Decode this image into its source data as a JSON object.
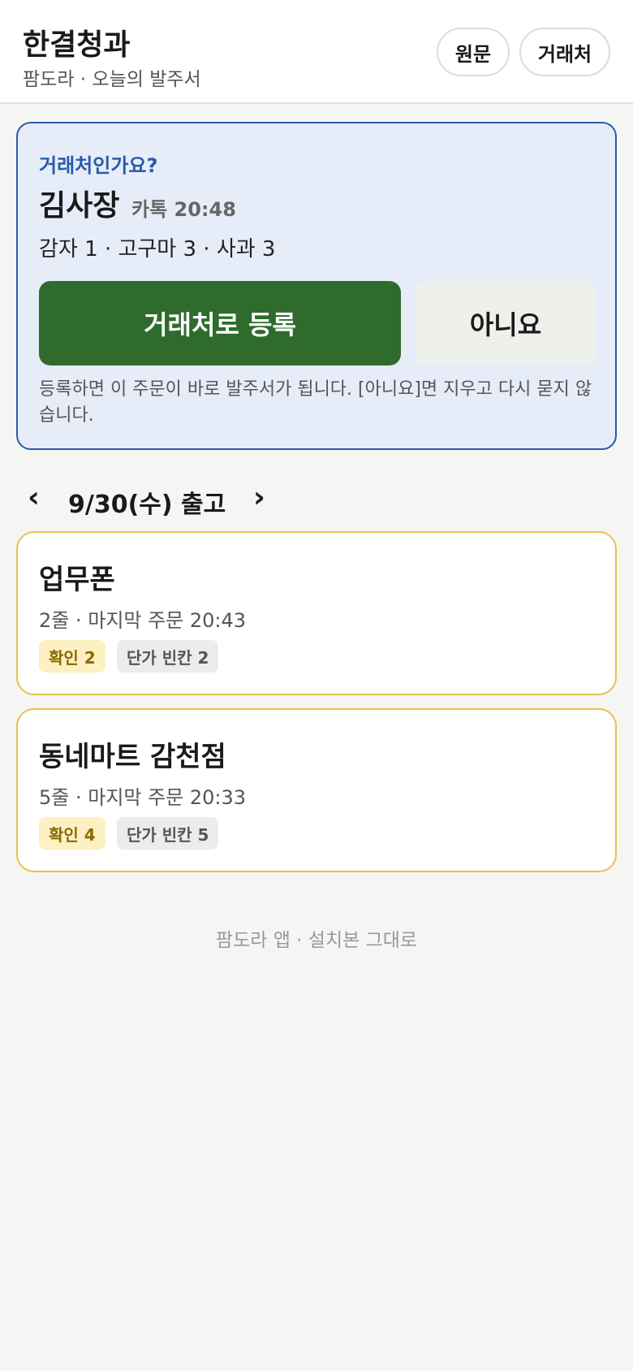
{
  "header": {
    "title": "한결청과",
    "subtitle": "팜도라 · 오늘의 발주서",
    "buttons": {
      "original": "원문",
      "vendor": "거래처"
    }
  },
  "prompt": {
    "question": "거래처인가요?",
    "name": "김사장",
    "meta": "카톡 20:48",
    "items": "감자 1 · 고구마 3 · 사과 3",
    "register_label": "거래처로 등록",
    "no_label": "아니요",
    "note": "등록하면 이 주문이 바로 발주서가 됩니다. [아니요]면 지우고 다시 묻지 않습니다."
  },
  "date_nav": {
    "prev": "‹",
    "label": "9/30(수) 출고",
    "next": "›"
  },
  "orders": [
    {
      "title": "업무폰",
      "subtitle": "2줄 · 마지막 주문 20:43",
      "badge_confirm": "확인 2",
      "badge_price": "단가 빈칸 2"
    },
    {
      "title": "동네마트 감천점",
      "subtitle": "5줄 · 마지막 주문 20:33",
      "badge_confirm": "확인 4",
      "badge_price": "단가 빈칸 5"
    }
  ],
  "footer": "팜도라 앱 · 설치본 그대로",
  "colors": {
    "accent_blue": "#2a5aa8",
    "primary_green": "#2f6b2d",
    "card_border_yellow": "#e8c24e"
  }
}
